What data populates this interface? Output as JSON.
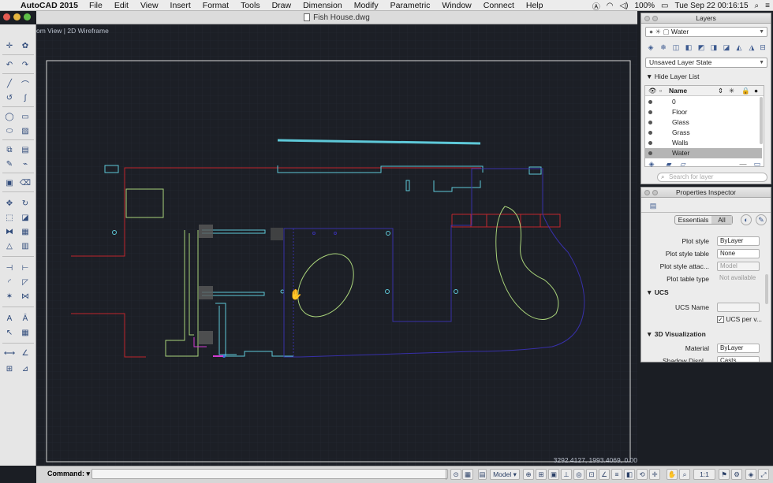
{
  "menubar": {
    "app_name": "AutoCAD 2015",
    "items": [
      "File",
      "Edit",
      "View",
      "Insert",
      "Format",
      "Tools",
      "Draw",
      "Dimension",
      "Modify",
      "Parametric",
      "Window",
      "Connect",
      "Help"
    ],
    "status": {
      "battery": "100%",
      "clock": "Tue Sep 22  00:16:15"
    }
  },
  "window": {
    "title": "Fish House.dwg"
  },
  "viewport": {
    "label": "om View | 2D Wireframe",
    "coordinates": "3292.4127, 1993.4069, 0.00"
  },
  "layers_panel": {
    "title": "Layers",
    "current_layer": "Water",
    "layer_state": "Unsaved Layer State",
    "hide_toggle": "Hide Layer List",
    "column_name": "Name",
    "layers": [
      "0",
      "Floor",
      "Glass",
      "Grass",
      "Walls",
      "Water"
    ],
    "selected_layer": "Water",
    "search_placeholder": "Search for layer"
  },
  "properties_panel": {
    "title": "Properties Inspector",
    "tab_essentials": "Essentials",
    "tab_all": "All",
    "rows": [
      {
        "label": "Plot style",
        "value": "ByLayer"
      },
      {
        "label": "Plot style table",
        "value": "None"
      },
      {
        "label": "Plot style attac...",
        "value": "Model"
      },
      {
        "label": "Plot table type",
        "value": "Not available"
      }
    ],
    "ucs_section": "UCS",
    "ucs_name_label": "UCS Name",
    "ucs_per_viewport": "UCS per v...",
    "viz_section": "3D Visualization",
    "material_label": "Material",
    "material_value": "ByLayer",
    "shadow_label": "Shadow Displ...",
    "shadow_value": "Casts..."
  },
  "command_bar": {
    "label": "Command:",
    "model_button": "Model",
    "scale": "1:1"
  },
  "colors": {
    "red": "#c0262c",
    "cyan": "#5ec8d8",
    "blue": "#3730a8",
    "green": "#a9d37a",
    "accent": "#3a78d8"
  }
}
